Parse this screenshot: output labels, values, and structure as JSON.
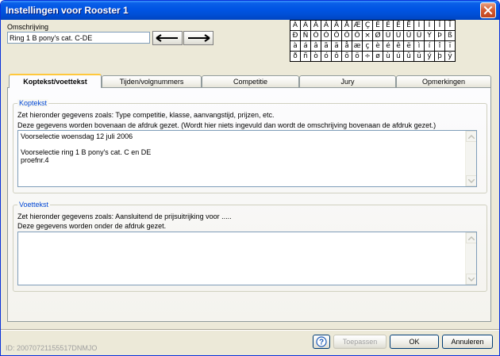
{
  "window": {
    "title": "Instellingen voor Rooster 1"
  },
  "omschrijving": {
    "label": "Omschrijving",
    "value": "Ring 1 B pony's cat. C-DE"
  },
  "charmap": {
    "rows": [
      [
        "À",
        "Á",
        "Â",
        "Ã",
        "Ä",
        "Å",
        "Æ",
        "Ç",
        "È",
        "É",
        "Ê",
        "Ë",
        "Ì",
        "Í",
        "Î",
        "Ï"
      ],
      [
        "Ð",
        "Ñ",
        "Ò",
        "Ó",
        "Ô",
        "Õ",
        "Ö",
        "×",
        "Ø",
        "Ù",
        "Ú",
        "Û",
        "Ü",
        "Ý",
        "Þ",
        "ß"
      ],
      [
        "à",
        "á",
        "â",
        "ã",
        "ä",
        "å",
        "æ",
        "ç",
        "è",
        "é",
        "ê",
        "ë",
        "ì",
        "í",
        "î",
        "ï"
      ],
      [
        "ð",
        "ñ",
        "ò",
        "ó",
        "ô",
        "õ",
        "ö",
        "÷",
        "ø",
        "ù",
        "ú",
        "û",
        "ü",
        "ý",
        "þ",
        "ÿ"
      ]
    ]
  },
  "tabs": [
    {
      "label": "Koptekst/voettekst",
      "active": true
    },
    {
      "label": "Tijden/volgnummers",
      "active": false
    },
    {
      "label": "Competitie",
      "active": false
    },
    {
      "label": "Jury",
      "active": false
    },
    {
      "label": "Opmerkingen",
      "active": false
    }
  ],
  "koptekst": {
    "title": "Koptekst",
    "desc1": "Zet hieronder gegevens zoals: Type competitie, klasse, aanvangstijd, prijzen, etc.",
    "desc2": "Deze gegevens worden bovenaan de afdruk gezet. (Wordt hier niets ingevuld dan wordt de omschrijving bovenaan de afdruk gezet.)",
    "text": "Voorselectie woensdag 12 juli 2006\n\nVoorselectie ring 1 B pony's cat. C en DE\nproefnr.4"
  },
  "voettekst": {
    "title": "Voettekst",
    "desc1": "Zet hieronder gegevens zoals: Aansluitend de prijsuitrijking voor .....",
    "desc2": "Deze gegevens worden onder de afdruk gezet.",
    "text": ""
  },
  "footer": {
    "id": "ID: 20070721155517DNMJO",
    "apply_label": "Toepassen",
    "ok_label": "OK",
    "cancel_label": "Annuleren"
  }
}
